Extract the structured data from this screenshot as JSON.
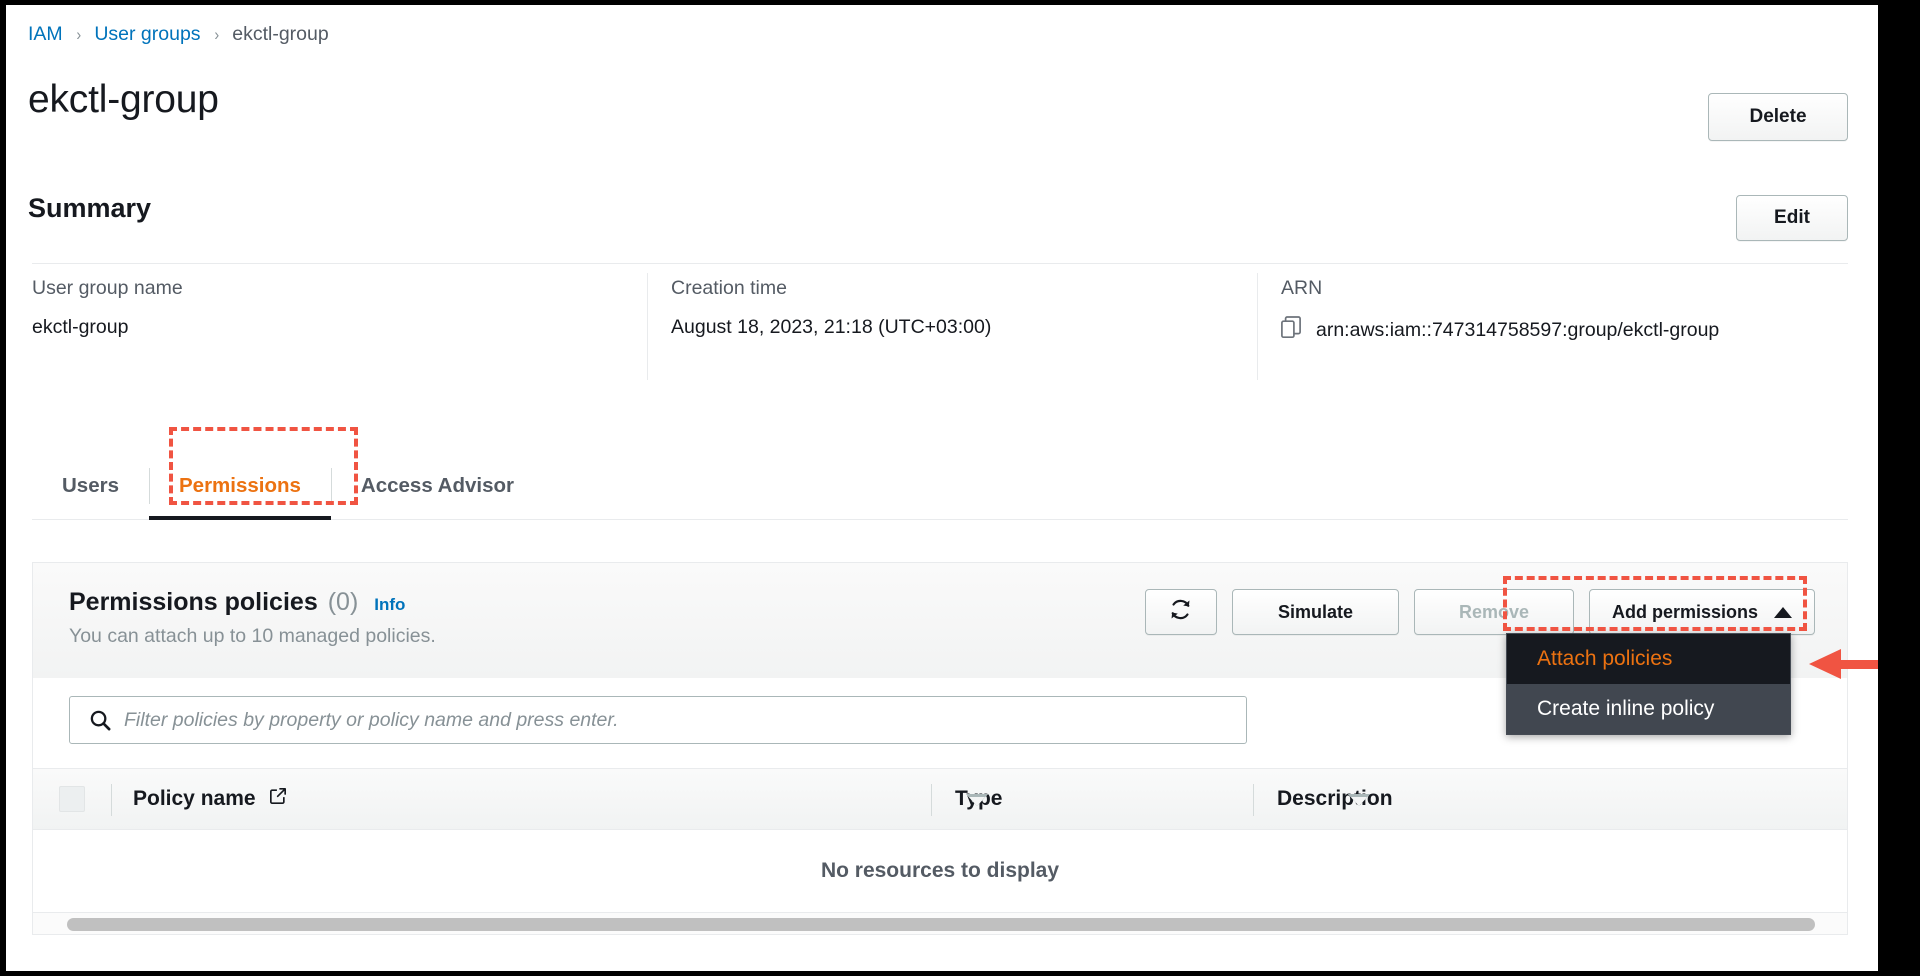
{
  "breadcrumb": {
    "items": [
      {
        "label": "IAM",
        "type": "link"
      },
      {
        "label": "User groups",
        "type": "link"
      },
      {
        "label": "ekctl-group",
        "type": "current"
      }
    ],
    "separator": "›"
  },
  "page": {
    "title": "ekctl-group",
    "delete_label": "Delete"
  },
  "summary": {
    "title": "Summary",
    "edit_label": "Edit",
    "fields": [
      {
        "label": "User group name",
        "value": "ekctl-group"
      },
      {
        "label": "Creation time",
        "value": "August 18, 2023, 21:18 (UTC+03:00)"
      },
      {
        "label": "ARN",
        "value": "arn:aws:iam::747314758597:group/ekctl-group"
      }
    ]
  },
  "tabs": [
    {
      "label": "Users",
      "active": false
    },
    {
      "label": "Permissions",
      "active": true
    },
    {
      "label": "Access Advisor",
      "active": false
    }
  ],
  "policies": {
    "heading": "Permissions policies",
    "count": "(0)",
    "info_label": "Info",
    "subtitle": "You can attach up to 10 managed policies.",
    "actions": {
      "refresh_icon": "refresh-icon",
      "simulate_label": "Simulate",
      "remove_label": "Remove",
      "add_permissions_label": "Add permissions"
    },
    "filter_placeholder": "Filter policies by property or policy name and press enter.",
    "filter_value": "",
    "table": {
      "columns": [
        "Policy name",
        "Type",
        "Description"
      ],
      "rows": [],
      "empty_message": "No resources to display"
    },
    "dropdown": {
      "open": true,
      "items": [
        {
          "label": "Attach policies",
          "state": "hover"
        },
        {
          "label": "Create inline policy",
          "state": "normal"
        }
      ]
    }
  },
  "colors": {
    "accent_orange": "#ec7211",
    "link_blue": "#0073bb",
    "annotation_red": "#f05442",
    "text_dark": "#16191f",
    "text_muted": "#879196"
  }
}
